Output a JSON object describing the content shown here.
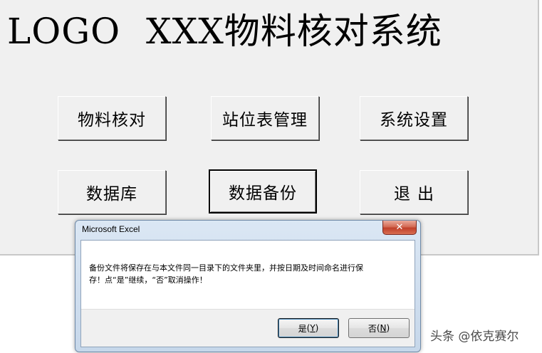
{
  "app": {
    "logo": "LOGO",
    "title": "XXX物料核对系统"
  },
  "buttons": {
    "material_check": "物料核对",
    "station_table": "站位表管理",
    "system_settings": "系统设置",
    "database": "数据库",
    "data_backup": "数据备份",
    "exit": "退出"
  },
  "dialog": {
    "title": "Microsoft Excel",
    "close_glyph": "✕",
    "message_line1": "备份文件将保存在与本文件同一目录下的文件夹里，并按日期及时间命名进行保",
    "message_line2": "存！点“是”继续，“否”取消操作！",
    "yes_label": "是",
    "yes_hotkey": "Y",
    "no_label": "否",
    "no_hotkey": "N"
  },
  "watermark": "头条 @依克赛尔"
}
